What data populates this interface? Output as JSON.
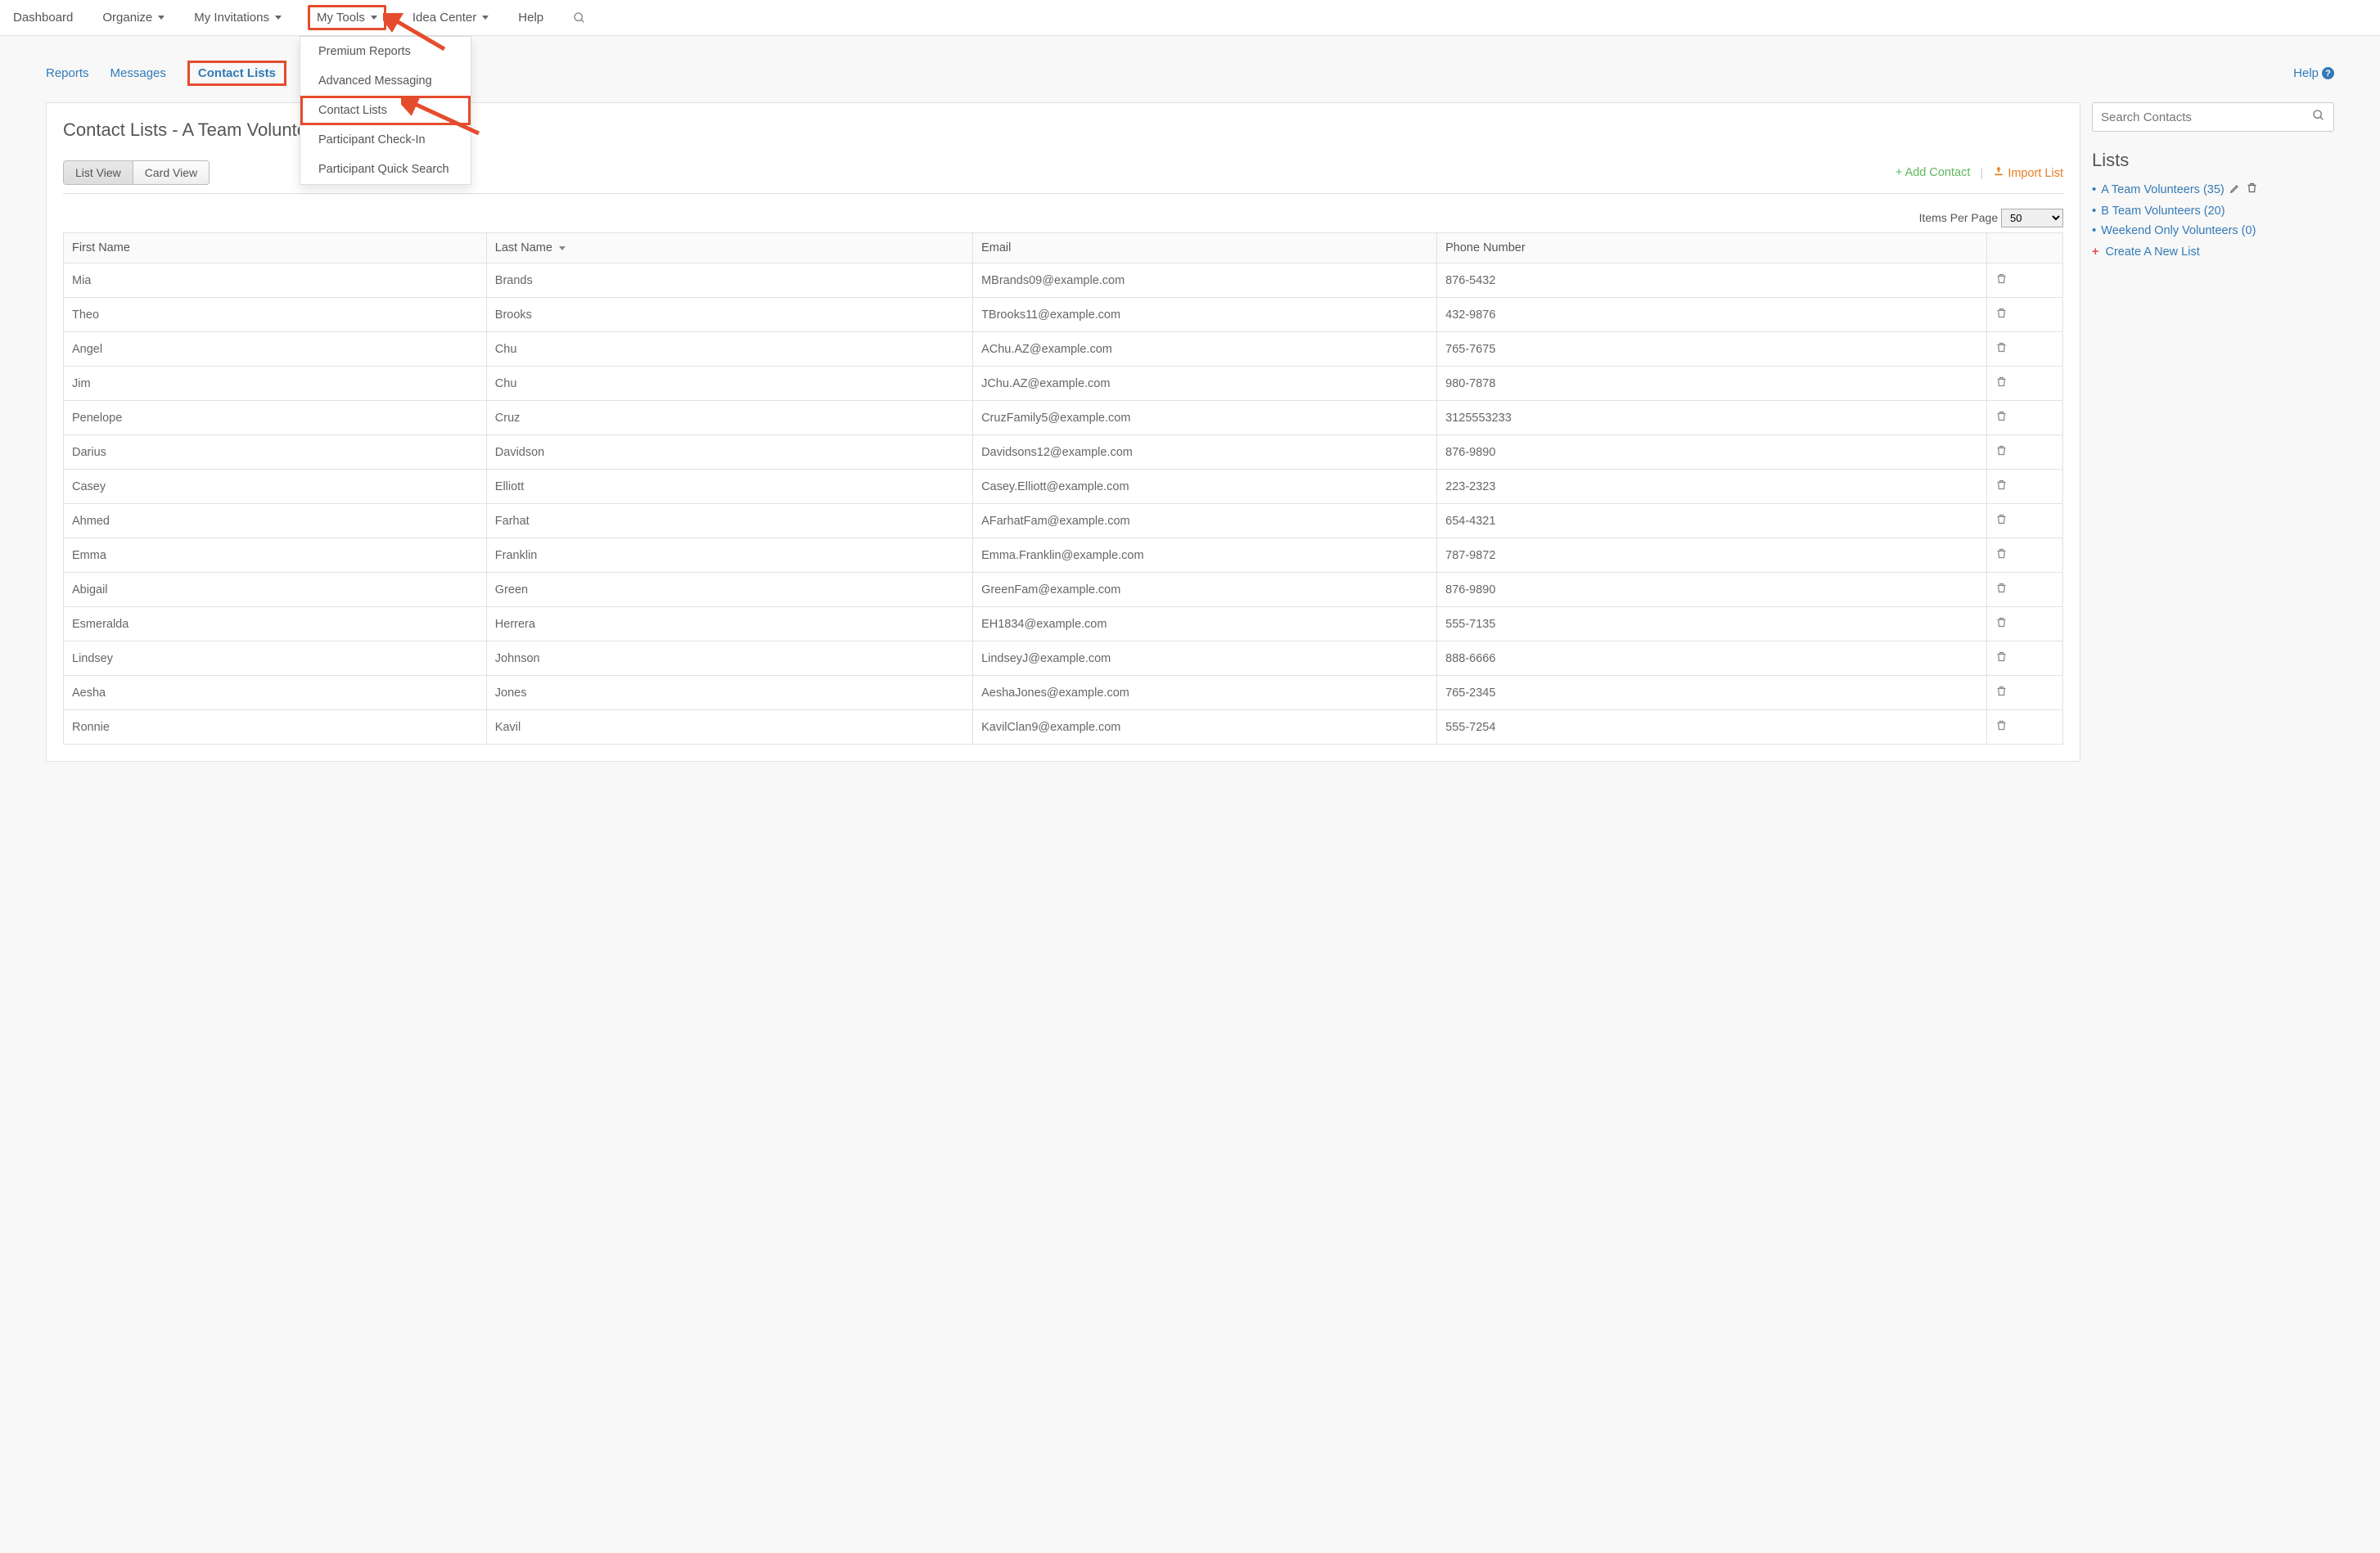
{
  "topnav": {
    "items": [
      {
        "label": "Dashboard",
        "dropdown": false
      },
      {
        "label": "Organize",
        "dropdown": true
      },
      {
        "label": "My Invitations",
        "dropdown": true
      },
      {
        "label": "My Tools",
        "dropdown": true,
        "highlight": true
      },
      {
        "label": "Idea Center",
        "dropdown": true
      },
      {
        "label": "Help",
        "dropdown": false
      }
    ]
  },
  "dropdown": {
    "items": [
      {
        "label": "Premium Reports"
      },
      {
        "label": "Advanced Messaging"
      },
      {
        "label": "Contact Lists",
        "highlight": true
      },
      {
        "label": "Participant Check-In"
      },
      {
        "label": "Participant Quick Search"
      }
    ]
  },
  "subtabs": {
    "items": [
      {
        "label": "Reports"
      },
      {
        "label": "Messages"
      },
      {
        "label": "Contact Lists",
        "active": true
      }
    ],
    "help_label": "Help"
  },
  "page": {
    "title": "Contact Lists - A Team Volunteers",
    "view_buttons": {
      "list": "List View",
      "card": "Card View"
    },
    "add_contact": "Add Contact",
    "import_list": "Import List",
    "items_per_page_label": "Items Per Page",
    "items_per_page_value": "50"
  },
  "table": {
    "headers": {
      "first": "First Name",
      "last": "Last Name",
      "email": "Email",
      "phone": "Phone Number"
    },
    "rows": [
      {
        "first": "Mia",
        "last": "Brands",
        "email": "MBrands09@example.com",
        "phone": "876-5432"
      },
      {
        "first": "Theo",
        "last": "Brooks",
        "email": "TBrooks11@example.com",
        "phone": "432-9876"
      },
      {
        "first": "Angel",
        "last": "Chu",
        "email": "AChu.AZ@example.com",
        "phone": "765-7675"
      },
      {
        "first": "Jim",
        "last": "Chu",
        "email": "JChu.AZ@example.com",
        "phone": "980-7878"
      },
      {
        "first": "Penelope",
        "last": "Cruz",
        "email": "CruzFamily5@example.com",
        "phone": "3125553233"
      },
      {
        "first": "Darius",
        "last": "Davidson",
        "email": "Davidsons12@example.com",
        "phone": "876-9890"
      },
      {
        "first": "Casey",
        "last": "Elliott",
        "email": "Casey.Elliott@example.com",
        "phone": "223-2323"
      },
      {
        "first": "Ahmed",
        "last": "Farhat",
        "email": "AFarhatFam@example.com",
        "phone": "654-4321"
      },
      {
        "first": "Emma",
        "last": "Franklin",
        "email": "Emma.Franklin@example.com",
        "phone": "787-9872"
      },
      {
        "first": "Abigail",
        "last": "Green",
        "email": "GreenFam@example.com",
        "phone": "876-9890"
      },
      {
        "first": "Esmeralda",
        "last": "Herrera",
        "email": "EH1834@example.com",
        "phone": "555-7135"
      },
      {
        "first": "Lindsey",
        "last": "Johnson",
        "email": "LindseyJ@example.com",
        "phone": "888-6666"
      },
      {
        "first": "Aesha",
        "last": "Jones",
        "email": "AeshaJones@example.com",
        "phone": "765-2345"
      },
      {
        "first": "Ronnie",
        "last": "Kavil",
        "email": "KavilClan9@example.com",
        "phone": "555-7254"
      }
    ]
  },
  "sidebar": {
    "search_placeholder": "Search Contacts",
    "lists_title": "Lists",
    "lists": [
      {
        "label": "A Team Volunteers (35)",
        "editable": true
      },
      {
        "label": "B Team Volunteers (20)"
      },
      {
        "label": "Weekend Only Volunteers (0)"
      }
    ],
    "create_label": "Create A New List"
  }
}
